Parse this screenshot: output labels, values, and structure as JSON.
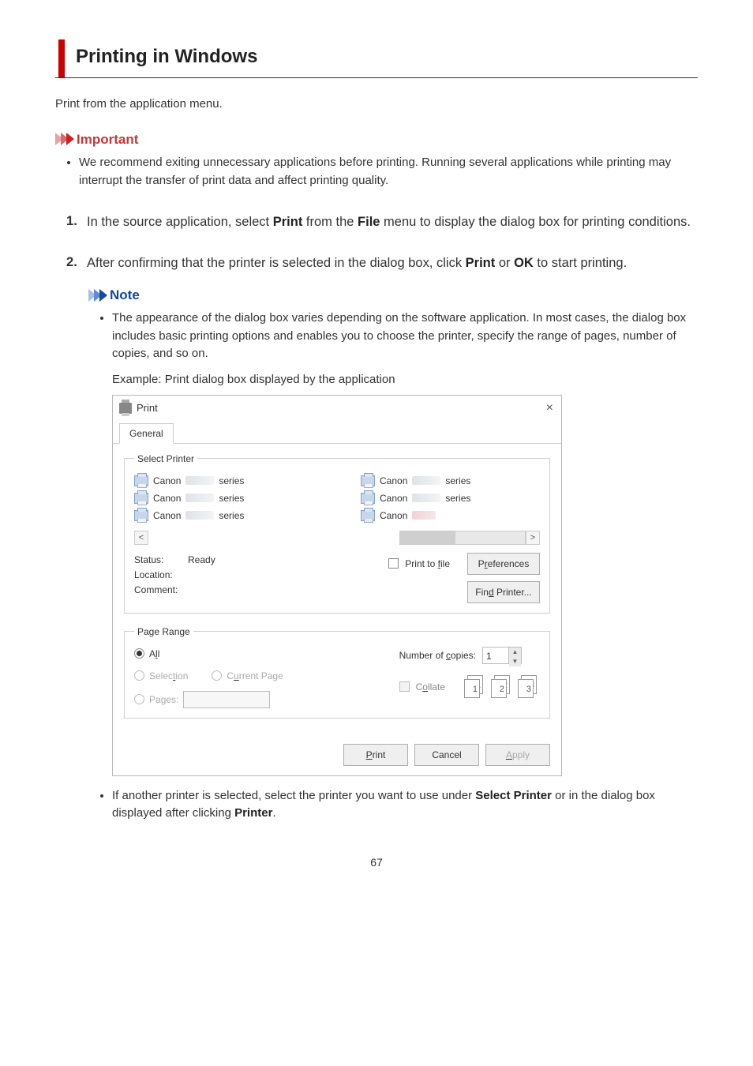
{
  "title": "Printing in Windows",
  "intro": "Print from the application menu.",
  "important": {
    "label": "Important",
    "bullet": "We recommend exiting unnecessary applications before printing. Running several applications while printing may interrupt the transfer of print data and affect printing quality."
  },
  "steps": {
    "s1": {
      "pre": "In the source application, select ",
      "b1": "Print",
      "mid": " from the ",
      "b2": "File",
      "post": " menu to display the dialog box for printing conditions."
    },
    "s2": {
      "pre": "After confirming that the printer is selected in the dialog box, click ",
      "b1": "Print",
      "mid": " or ",
      "b2": "OK",
      "post": " to start printing."
    }
  },
  "note": {
    "label": "Note",
    "n1": "The appearance of the dialog box varies depending on the software application. In most cases, the dialog box includes basic printing options and enables you to choose the printer, specify the range of pages, number of copies, and so on.",
    "example_caption": "Example: Print dialog box displayed by the application",
    "n2_pre": "If another printer is selected, select the printer you want to use under ",
    "n2_b1": "Select Printer",
    "n2_mid": " or in the dialog box displayed after clicking ",
    "n2_b2": "Printer",
    "n2_post": "."
  },
  "dialog": {
    "title": "Print",
    "close": "×",
    "tab": "General",
    "select_printer_label": "Select Printer",
    "printer_name_prefix": "Canon",
    "printer_name_suffix": "series",
    "scroll_left": "<",
    "scroll_right": ">",
    "status_label": "Status:",
    "status_value": "Ready",
    "location_label": "Location:",
    "comment_label": "Comment:",
    "print_to_file": "Print to file",
    "preferences_btn": "Preferences",
    "find_printer_btn": "Find Printer...",
    "page_range_label": "Page Range",
    "all_label": "All",
    "selection_label": "Selection",
    "current_page_label": "Current Page",
    "pages_label": "Pages:",
    "copies_label": "Number of copies:",
    "copies_value": "1",
    "collate_label": "Collate",
    "stack1": "1",
    "stack2": "2",
    "stack3": "3",
    "print_btn": "Print",
    "cancel_btn": "Cancel",
    "apply_btn": "Apply"
  },
  "page_number": "67"
}
